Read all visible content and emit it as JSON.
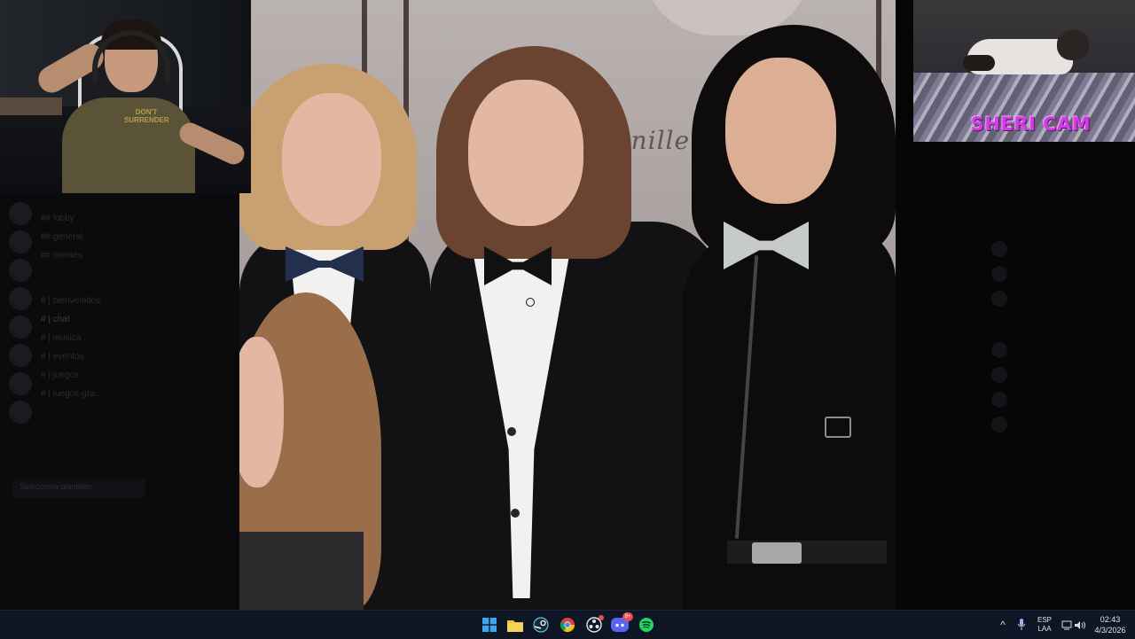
{
  "overlay": {
    "cam_label": "SHERI CAM",
    "webcam_shirt_text": "DON'T\nSURRENDER"
  },
  "photo": {
    "background_sign": "Bnillen"
  },
  "discord_bg": {
    "channels": [
      "## lobby",
      "## general",
      "## memes",
      "# | bienvenidos",
      "# | chat",
      "# | musica",
      "# | eventos",
      "# | juegos",
      "# | juegos-gra..."
    ],
    "notice": "Selecciona plantillas"
  },
  "taskbar": {
    "apps": [
      {
        "name": "windows-start",
        "icon": "⊞"
      },
      {
        "name": "file-explorer",
        "icon": "📁"
      },
      {
        "name": "steam",
        "icon": "♨"
      },
      {
        "name": "chrome",
        "icon": "◉"
      },
      {
        "name": "obs",
        "icon": "◎"
      },
      {
        "name": "discord",
        "icon": "☺",
        "badge": "9+"
      },
      {
        "name": "spotify",
        "icon": "≋"
      }
    ],
    "tray": {
      "chevron": "^",
      "mic": "🎙",
      "lang_top": "ESP",
      "lang_bottom": "LAA",
      "time": "02:43",
      "date": "4/3/2026"
    }
  },
  "colors": {
    "taskbar_bg": "#0e1626",
    "cam_label": "#d03de0",
    "discord_badge": "#e2504a"
  }
}
